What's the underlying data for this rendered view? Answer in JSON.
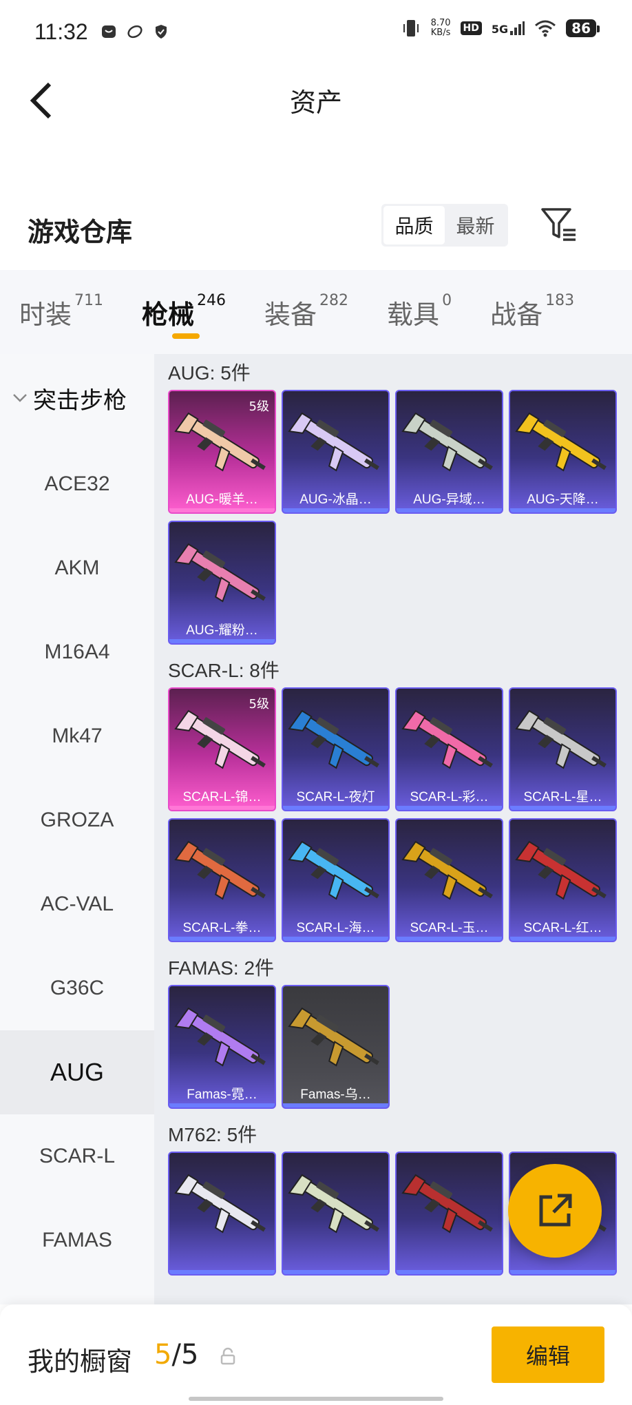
{
  "status_bar": {
    "time": "11:32",
    "net_speed_value": "8.70",
    "net_speed_unit": "KB/s",
    "hd": "HD",
    "network": "5G",
    "battery": "86"
  },
  "nav": {
    "title": "资产"
  },
  "warehouse": {
    "title": "游戏仓库",
    "sort_options": [
      "品质",
      "最新"
    ]
  },
  "category_tabs": [
    {
      "label": "时装",
      "count": "711"
    },
    {
      "label": "枪械",
      "count": "246"
    },
    {
      "label": "装备",
      "count": "282"
    },
    {
      "label": "载具",
      "count": "0"
    },
    {
      "label": "战备",
      "count": "183"
    }
  ],
  "sidebar": {
    "group": "突击步枪",
    "items": [
      "ACE32",
      "AKM",
      "M16A4",
      "Mk47",
      "GROZA",
      "AC-VAL",
      "G36C",
      "AUG",
      "SCAR-L",
      "FAMAS"
    ]
  },
  "groups": [
    {
      "title": "AUG: 5件",
      "items": [
        {
          "name": "AUG-暖羊…",
          "level": "5级",
          "style": "gold",
          "gun_color": "#f0c9a8"
        },
        {
          "name": "AUG-冰晶…",
          "level": "",
          "style": "purple",
          "gun_color": "#d8c9f4"
        },
        {
          "name": "AUG-异域…",
          "level": "",
          "style": "purple",
          "gun_color": "#c9d2c8"
        },
        {
          "name": "AUG-天降…",
          "level": "",
          "style": "purple",
          "gun_color": "#f2c21e"
        },
        {
          "name": "AUG-耀粉…",
          "level": "",
          "style": "purple",
          "gun_color": "#e87fb0"
        }
      ]
    },
    {
      "title": "SCAR-L: 8件",
      "items": [
        {
          "name": "SCAR-L-锦…",
          "level": "5级",
          "style": "gold",
          "gun_color": "#f4d6e6"
        },
        {
          "name": "SCAR-L-夜灯",
          "level": "",
          "style": "purple",
          "gun_color": "#2a7fd4"
        },
        {
          "name": "SCAR-L-彩…",
          "level": "",
          "style": "purple",
          "gun_color": "#f06aa8"
        },
        {
          "name": "SCAR-L-星…",
          "level": "",
          "style": "purple",
          "gun_color": "#c8c8c8"
        },
        {
          "name": "SCAR-L-拳…",
          "level": "",
          "style": "purple",
          "gun_color": "#e06a40"
        },
        {
          "name": "SCAR-L-海…",
          "level": "",
          "style": "purple",
          "gun_color": "#48b6f2"
        },
        {
          "name": "SCAR-L-玉…",
          "level": "",
          "style": "purple",
          "gun_color": "#d9a21a"
        },
        {
          "name": "SCAR-L-红…",
          "level": "",
          "style": "purple",
          "gun_color": "#c83232"
        }
      ]
    },
    {
      "title": "FAMAS: 2件",
      "items": [
        {
          "name": "Famas-霓…",
          "level": "",
          "style": "purple",
          "gun_color": "#b07cf0"
        },
        {
          "name": "Famas-乌…",
          "level": "",
          "style": "grey",
          "gun_color": "#c89a30"
        }
      ]
    },
    {
      "title": "M762: 5件",
      "items": [
        {
          "name": "",
          "level": "",
          "style": "purple",
          "gun_color": "#e8e8f0"
        },
        {
          "name": "",
          "level": "",
          "style": "purple",
          "gun_color": "#d8e0c4"
        },
        {
          "name": "",
          "level": "",
          "style": "purple",
          "gun_color": "#b83030"
        },
        {
          "name": "",
          "level": "",
          "style": "purple",
          "gun_color": "#f2c21e"
        }
      ]
    }
  ],
  "bottom": {
    "showcase_label": "我的橱窗",
    "showcase_current": "5",
    "showcase_sep": "/",
    "showcase_total": "5",
    "edit_label": "编辑"
  },
  "colors": {
    "accent": "#f7b300",
    "legendary_border": "#e84ac9",
    "epic_border": "#6a5cf0"
  },
  "icons": {
    "back": "chevron-left-icon",
    "filter": "filter-icon",
    "share": "share-icon",
    "lock": "lock-icon"
  }
}
